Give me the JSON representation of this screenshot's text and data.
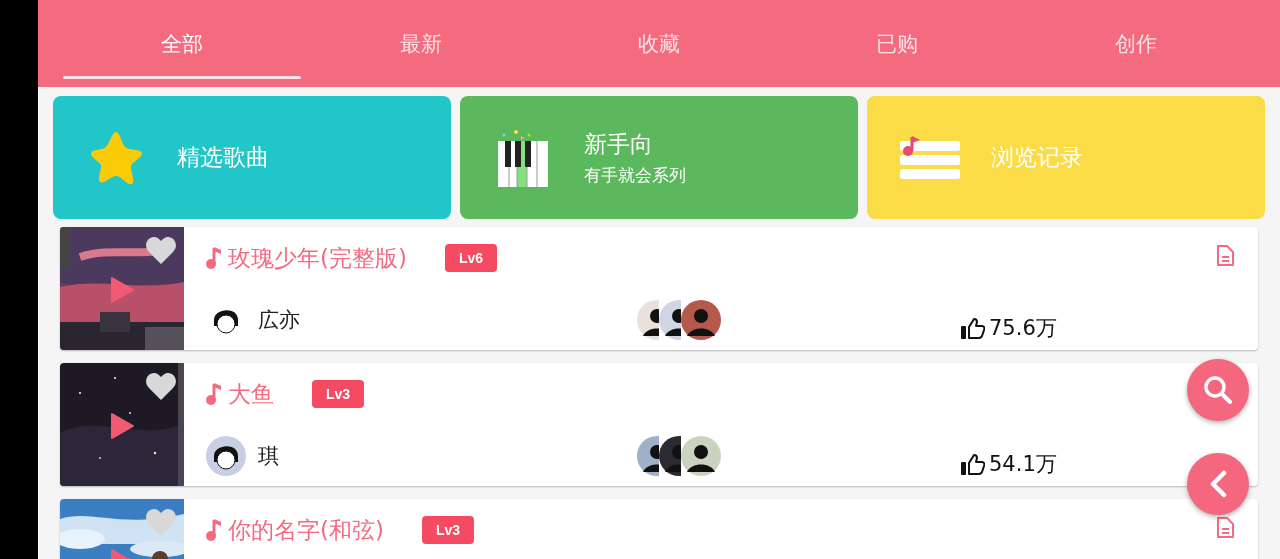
{
  "tabs": [
    {
      "label": "全部",
      "selected": true
    },
    {
      "label": "最新",
      "selected": false
    },
    {
      "label": "收藏",
      "selected": false
    },
    {
      "label": "已购",
      "selected": false
    },
    {
      "label": "创作",
      "selected": false
    }
  ],
  "categories": [
    {
      "kind": "star",
      "title": "精选歌曲",
      "color": "#22c6c9"
    },
    {
      "kind": "piano",
      "title": "新手向",
      "subtitle": "有手就会系列",
      "color": "#5cb85c"
    },
    {
      "kind": "history",
      "title": "浏览记录",
      "color": "#fbdc46"
    }
  ],
  "songs": [
    {
      "title": "玫瑰少年(完整版)",
      "level": "Lv6",
      "favorite": false,
      "has_sheet": true,
      "author": "広亦",
      "likes": "75.6万"
    },
    {
      "title": "大鱼",
      "level": "Lv3",
      "favorite": false,
      "author": "琪",
      "likes": "54.1万"
    },
    {
      "title": "你的名字(和弦)",
      "level": "Lv3",
      "favorite": false,
      "has_sheet": true
    }
  ]
}
